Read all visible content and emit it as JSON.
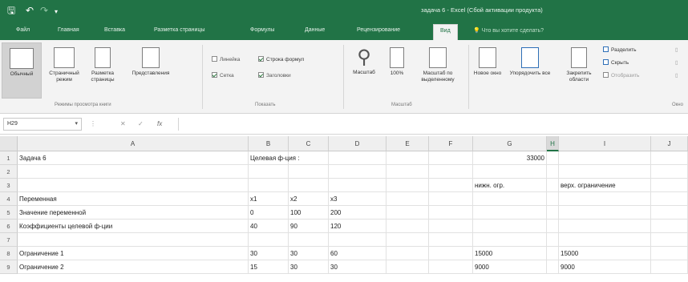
{
  "window": {
    "title": "задача 6 - Excel (Сбой активации продукта)"
  },
  "ribbon_tabs": [
    "Файл",
    "Главная",
    "Вставка",
    "Разметка страницы",
    "Формулы",
    "Данные",
    "Рецензирование",
    "Вид"
  ],
  "tell_me": "Что вы хотите сделать?",
  "ribbon": {
    "view_modes": [
      "Обычный",
      "Страничный режим",
      "Разметка страницы",
      "Представления"
    ],
    "view_modes_group": "Режимы просмотра книги",
    "show": {
      "ruler": "Линейка",
      "formula_bar": "Строка формул",
      "gridlines": "Сетка",
      "headings": "Заголовки",
      "group": "Показать"
    },
    "zoom": {
      "zoom": "Масштаб",
      "zoom100": "100%",
      "zoom_selection": "Масштаб по выделенному",
      "group": "Масштаб"
    },
    "window": {
      "new_window": "Новое окно",
      "arrange_all": "Упорядочить все",
      "freeze_panes": "Закрепить области",
      "split": "Разделить",
      "hide": "Скрыть",
      "unhide": "Отобразить",
      "group": "Окно"
    }
  },
  "formula_bar": {
    "name_box": "H29",
    "cancel": "✕",
    "enter": "✓",
    "fx": "fx",
    "value": ""
  },
  "grid": {
    "columns": [
      "A",
      "B",
      "C",
      "D",
      "E",
      "F",
      "G",
      "H",
      "I",
      "J"
    ],
    "selected_column": "H",
    "rows": [
      {
        "n": "1",
        "A": "Задача 6",
        "B": "Целевая ф-ция :",
        "G": "33000"
      },
      {
        "n": "2"
      },
      {
        "n": "3",
        "G": "нижн. огр.",
        "I": "верх. ограничение"
      },
      {
        "n": "4",
        "A": "Переменная",
        "B": "x1",
        "C": "x2",
        "D": "x3"
      },
      {
        "n": "5",
        "A": "Значение переменной",
        "B": "0",
        "C": "100",
        "D": "200"
      },
      {
        "n": "6",
        "A": "Коэффициенты целевой ф-ции",
        "B": "40",
        "C": "90",
        "D": "120"
      },
      {
        "n": "7"
      },
      {
        "n": "8",
        "A": "Ограничение 1",
        "B": "30",
        "C": "30",
        "D": "60",
        "G": "15000",
        "I": "15000"
      },
      {
        "n": "9",
        "A": "Ограничение 2",
        "B": "15",
        "C": "30",
        "D": "30",
        "G": "9000",
        "I": "9000"
      }
    ]
  }
}
